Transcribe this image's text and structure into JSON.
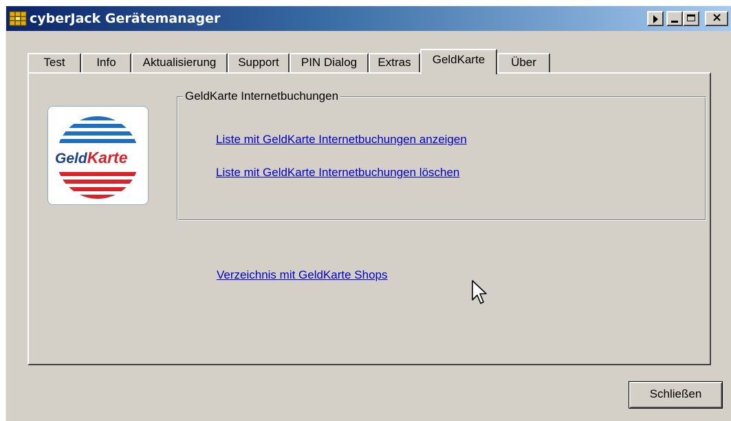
{
  "window": {
    "title": "cyberJack Gerätemanager"
  },
  "tabs": [
    {
      "label": "Test",
      "active": false
    },
    {
      "label": "Info",
      "active": false
    },
    {
      "label": "Aktualisierung",
      "active": false
    },
    {
      "label": "Support",
      "active": false
    },
    {
      "label": "PIN Dialog",
      "active": false
    },
    {
      "label": "Extras",
      "active": false
    },
    {
      "label": "GeldKarte",
      "active": true
    },
    {
      "label": "Über",
      "active": false
    }
  ],
  "logo": {
    "text_part1": "Geld",
    "text_part2": "Karte",
    "colors": {
      "blue": "#1e6fc0",
      "red": "#d8232a",
      "text": "#1c3f8a"
    }
  },
  "group": {
    "label": "GeldKarte Internetbuchungen",
    "link_show": "Liste mit GeldKarte Internetbuchungen anzeigen",
    "link_delete": "Liste mit GeldKarte Internetbuchungen löschen"
  },
  "shops_link": "Verzeichnis mit GeldKarte Shops",
  "buttons": {
    "close_label": "Schließen"
  },
  "colors": {
    "face": "#d4d0c8",
    "title_start": "#0a246a",
    "title_end": "#a6caf0",
    "link": "#0000cc"
  }
}
